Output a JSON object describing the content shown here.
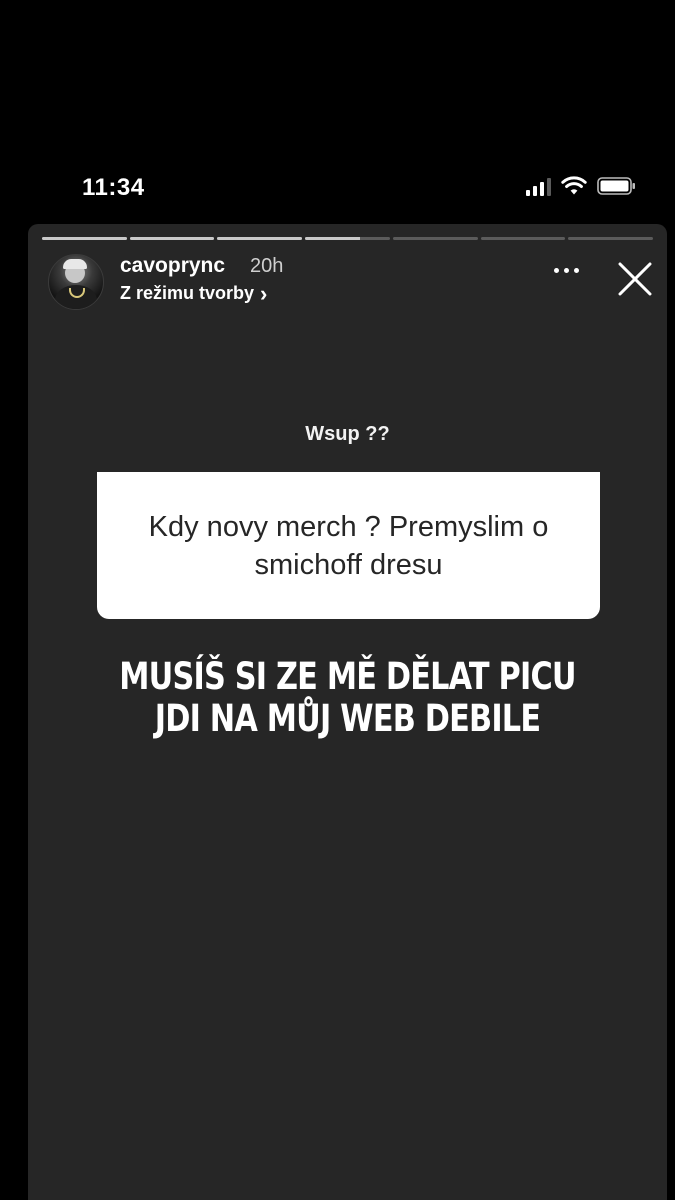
{
  "status_bar": {
    "time": "11:34",
    "icons": [
      "cellular-signal-icon",
      "wifi-icon",
      "battery-icon"
    ]
  },
  "story": {
    "progress_segments": [
      1,
      1,
      1,
      0.65,
      0,
      0,
      0
    ],
    "user": {
      "username": "cavoprync",
      "time_ago": "20h",
      "subtitle": "Z režimu tvorby",
      "subtitle_chevron": "›"
    },
    "question_sticker": {
      "prompt": "Wsup ??",
      "question": "Kdy novy merch ? Premyslim o smichoff dresu"
    },
    "answer_text": "MUSÍŠ SI ZE MĚ DĚLAT PICU JDI NA MŮJ WEB DEBILE"
  },
  "colors": {
    "background": "#000000",
    "story_background": "#262626",
    "sticker_background": "#ffffff",
    "text": "#ffffff"
  }
}
